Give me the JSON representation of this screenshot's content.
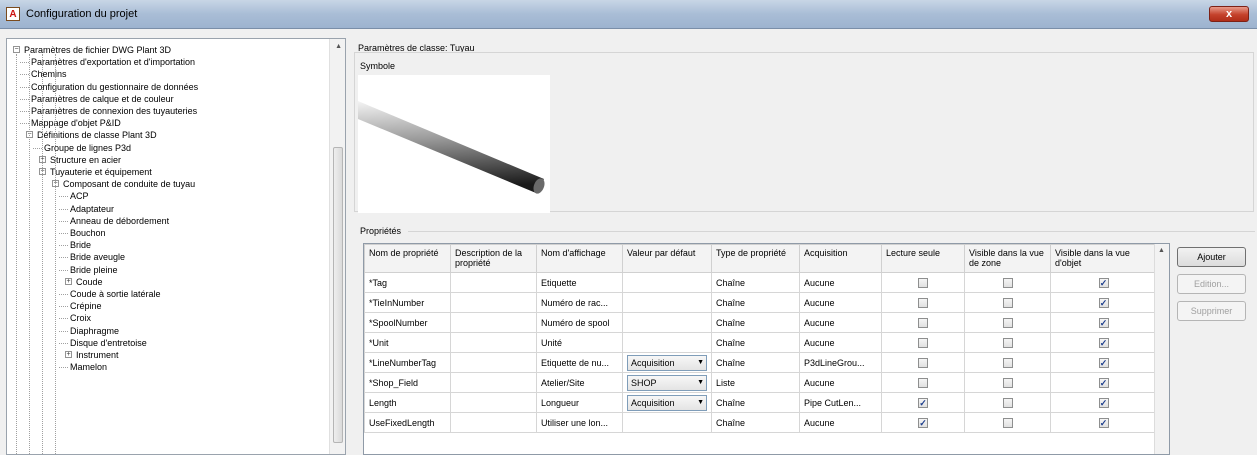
{
  "window": {
    "title": "Configuration du projet",
    "icon": "autocad-app-icon",
    "close_label": "x"
  },
  "tree": {
    "items": [
      {
        "label": "Paramètres de fichier DWG Plant 3D",
        "level": 0,
        "expander": "minus"
      },
      {
        "label": "Paramètres d'exportation et d'importation",
        "level": 1,
        "expander": ""
      },
      {
        "label": "Chemins",
        "level": 1,
        "expander": ""
      },
      {
        "label": "Configuration du gestionnaire de données",
        "level": 1,
        "expander": ""
      },
      {
        "label": "Paramètres de calque et de couleur",
        "level": 1,
        "expander": ""
      },
      {
        "label": "Paramètres de connexion des tuyauteries",
        "level": 1,
        "expander": ""
      },
      {
        "label": "Mappage d'objet P&ID",
        "level": 1,
        "expander": ""
      },
      {
        "label": "Définitions de classe Plant 3D",
        "level": 1,
        "expander": "minus"
      },
      {
        "label": "Groupe de lignes P3d",
        "level": 2,
        "expander": ""
      },
      {
        "label": "Structure en acier",
        "level": 2,
        "expander": "plus"
      },
      {
        "label": "Tuyauterie et équipement",
        "level": 2,
        "expander": "minus"
      },
      {
        "label": "Composant de conduite de tuyau",
        "level": 3,
        "expander": "minus"
      },
      {
        "label": "ACP",
        "level": 4,
        "expander": ""
      },
      {
        "label": "Adaptateur",
        "level": 4,
        "expander": ""
      },
      {
        "label": "Anneau de débordement",
        "level": 4,
        "expander": ""
      },
      {
        "label": "Bouchon",
        "level": 4,
        "expander": ""
      },
      {
        "label": "Bride",
        "level": 4,
        "expander": ""
      },
      {
        "label": "Bride aveugle",
        "level": 4,
        "expander": ""
      },
      {
        "label": "Bride pleine",
        "level": 4,
        "expander": ""
      },
      {
        "label": "Coude",
        "level": 4,
        "expander": "plus"
      },
      {
        "label": "Coude à sortie latérale",
        "level": 4,
        "expander": ""
      },
      {
        "label": "Crépine",
        "level": 4,
        "expander": ""
      },
      {
        "label": "Croix",
        "level": 4,
        "expander": ""
      },
      {
        "label": "Diaphragme",
        "level": 4,
        "expander": ""
      },
      {
        "label": "Disque d'entretoise",
        "level": 4,
        "expander": ""
      },
      {
        "label": "Instrument",
        "level": 4,
        "expander": "plus"
      },
      {
        "label": "Mamelon",
        "level": 4,
        "expander": ""
      }
    ]
  },
  "class_params": {
    "title": "Paramètres de classe: Tuyau"
  },
  "symbol": {
    "label": "Symbole"
  },
  "properties": {
    "label": "Propriétés",
    "columns": [
      "Nom de propriété",
      "Description de la propriété",
      "Nom d'affichage",
      "Valeur par défaut",
      "Type de propriété",
      "Acquisition",
      "Lecture seule",
      "Visible dans la vue de zone",
      "Visible dans la vue d'objet"
    ],
    "rows": [
      {
        "name": "*Tag",
        "desc": "",
        "display": "Etiquette",
        "default": "",
        "default_combo": false,
        "type": "Chaîne",
        "acq": "Aucune",
        "ro": false,
        "vzone": false,
        "vobj": true
      },
      {
        "name": "*TieInNumber",
        "desc": "",
        "display": "Numéro de rac...",
        "default": "",
        "default_combo": false,
        "type": "Chaîne",
        "acq": "Aucune",
        "ro": false,
        "vzone": false,
        "vobj": true
      },
      {
        "name": "*SpoolNumber",
        "desc": "",
        "display": "Numéro de spool",
        "default": "",
        "default_combo": false,
        "type": "Chaîne",
        "acq": "Aucune",
        "ro": false,
        "vzone": false,
        "vobj": true
      },
      {
        "name": "*Unit",
        "desc": "",
        "display": "Unité",
        "default": "",
        "default_combo": false,
        "type": "Chaîne",
        "acq": "Aucune",
        "ro": false,
        "vzone": false,
        "vobj": true
      },
      {
        "name": "*LineNumberTag",
        "desc": "",
        "display": "Etiquette de nu...",
        "default": "Acquisition",
        "default_combo": true,
        "type": "Chaîne",
        "acq": "P3dLineGrou...",
        "ro": false,
        "vzone": false,
        "vobj": true
      },
      {
        "name": "*Shop_Field",
        "desc": "",
        "display": "Atelier/Site",
        "default": "SHOP",
        "default_combo": true,
        "type": "Liste",
        "acq": "Aucune",
        "ro": false,
        "vzone": false,
        "vobj": true
      },
      {
        "name": "Length",
        "desc": "",
        "display": "Longueur",
        "default": "Acquisition",
        "default_combo": true,
        "type": "Chaîne",
        "acq": "Pipe CutLen...",
        "ro": true,
        "vzone": false,
        "vobj": true
      },
      {
        "name": "UseFixedLength",
        "desc": "",
        "display": "Utiliser une lon...",
        "default": "",
        "default_combo": false,
        "type": "Chaîne",
        "acq": "Aucune",
        "ro": true,
        "vzone": false,
        "vobj": true
      }
    ]
  },
  "buttons": {
    "add": "Ajouter",
    "edit": "Edition...",
    "delete": "Supprimer"
  }
}
